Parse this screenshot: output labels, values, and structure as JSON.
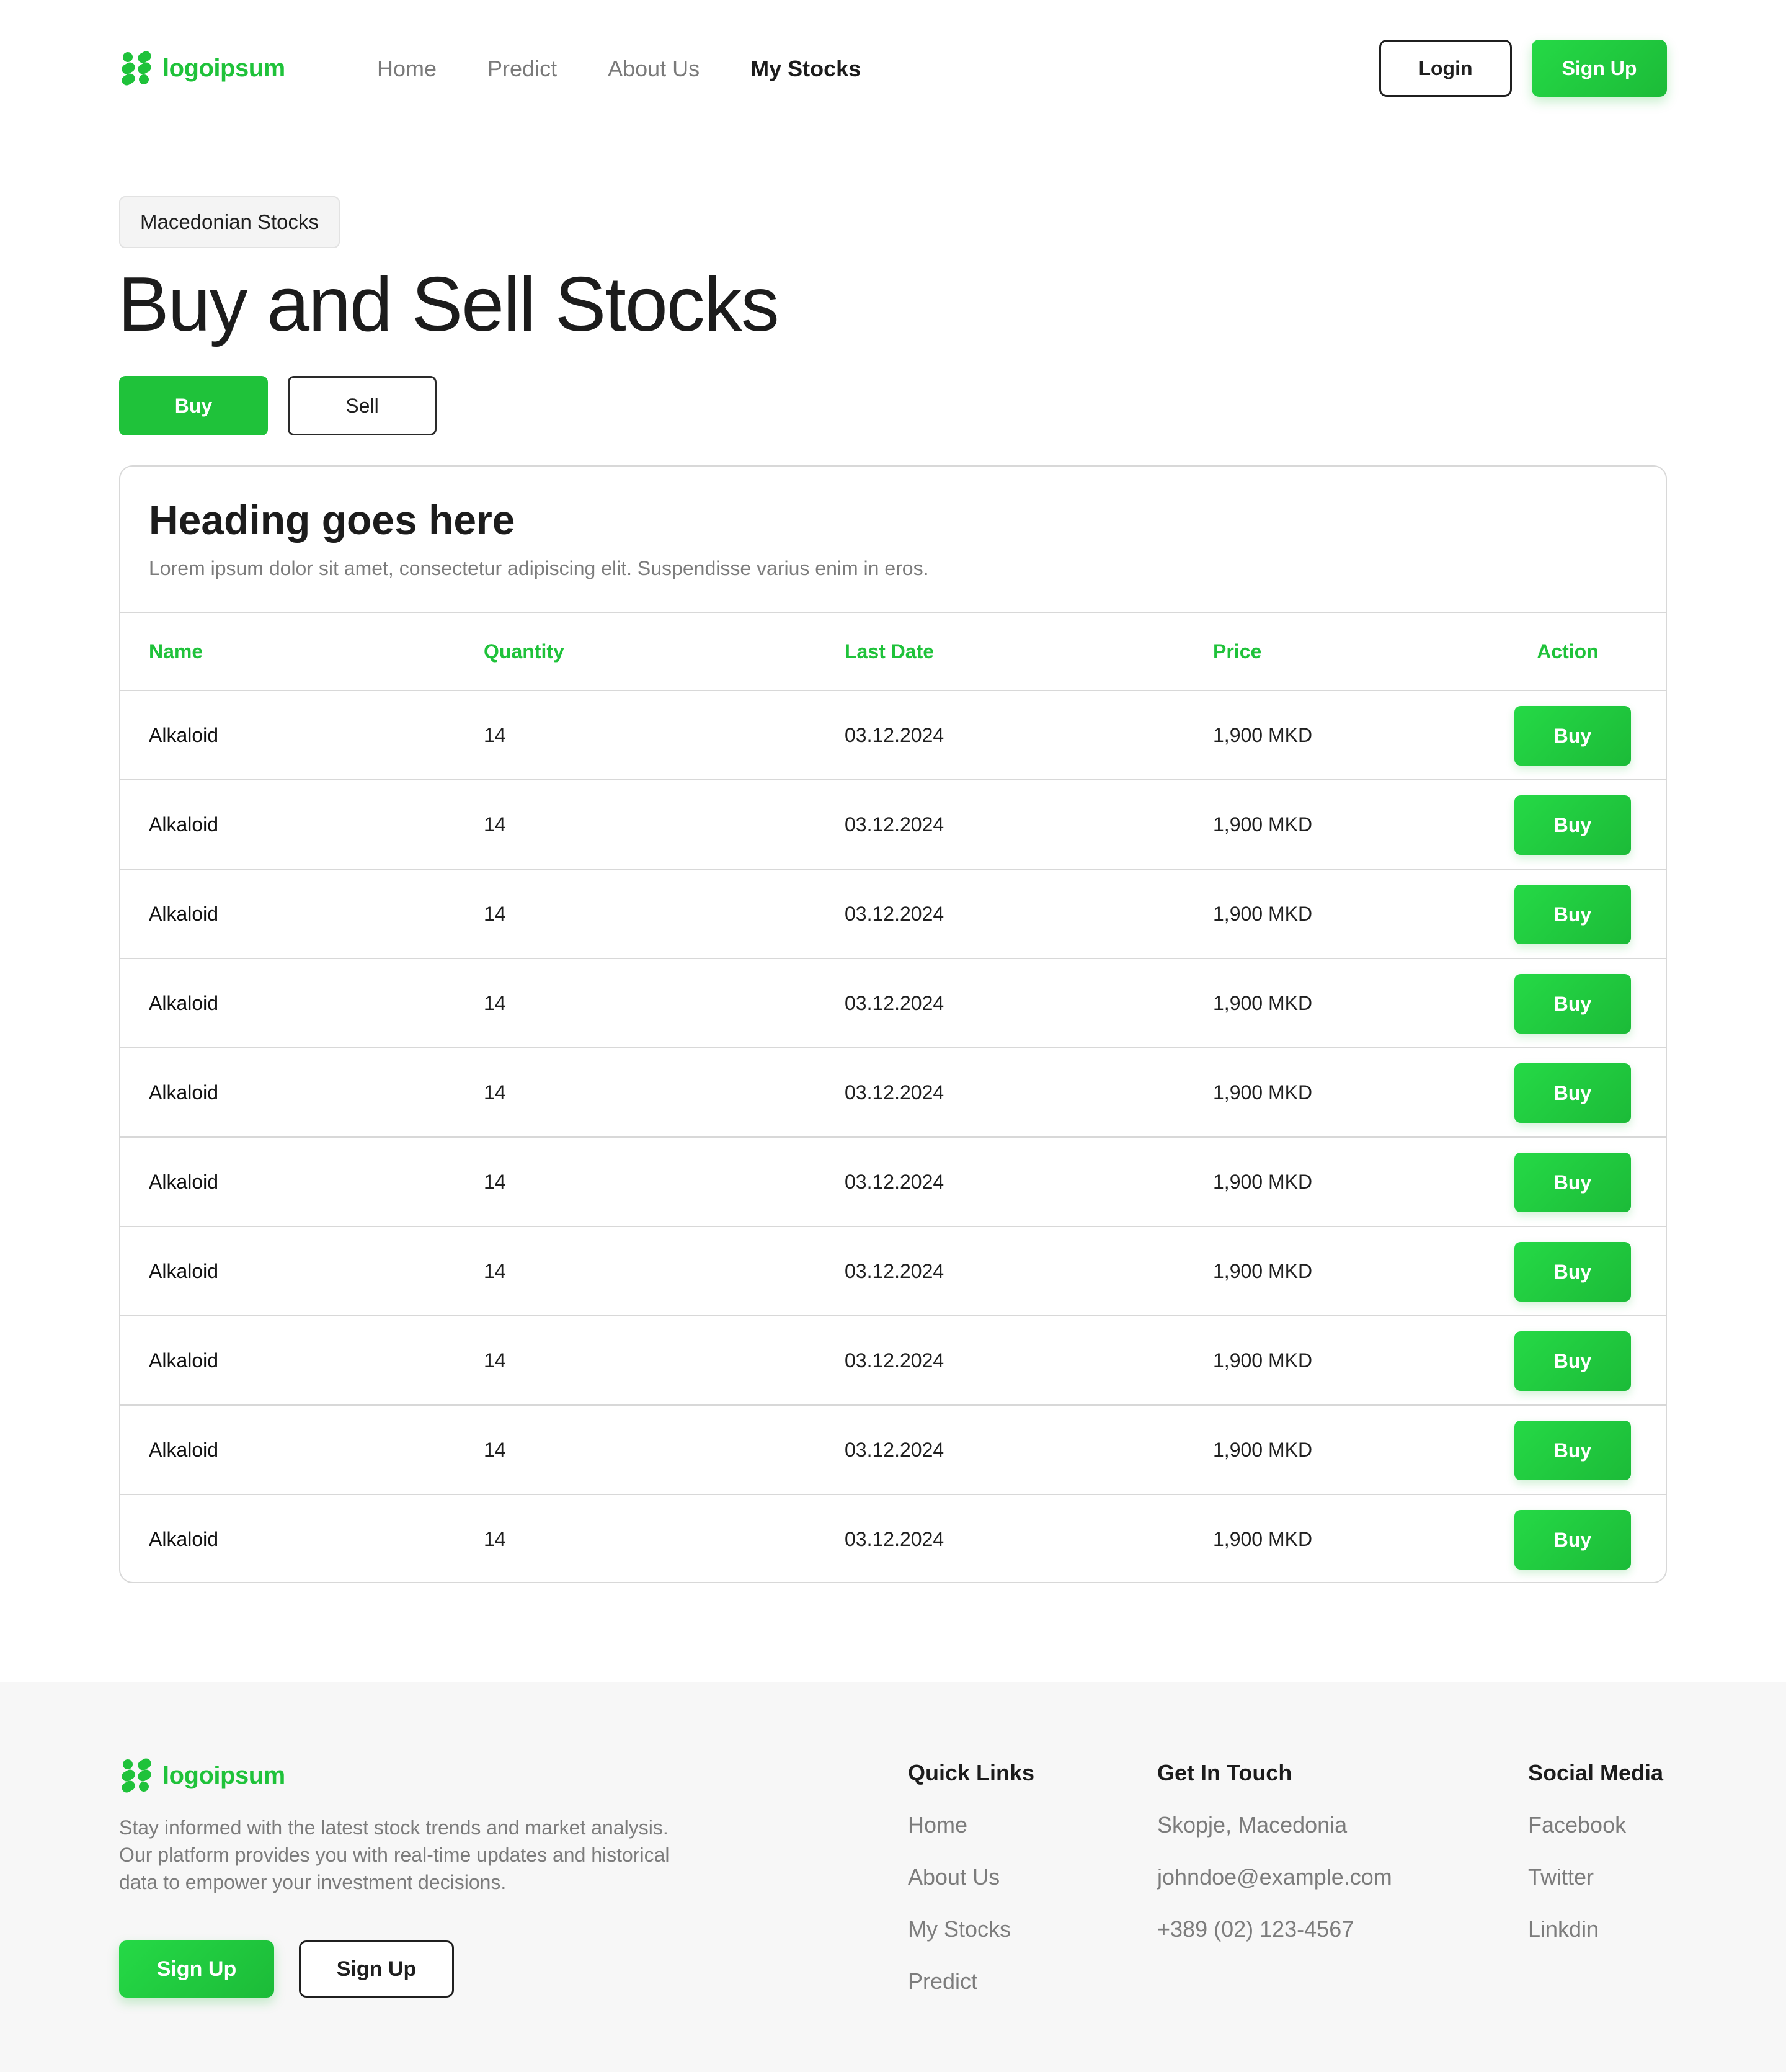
{
  "header": {
    "logo_text": "logoipsum",
    "nav": [
      {
        "label": "Home",
        "active": false
      },
      {
        "label": "Predict",
        "active": false
      },
      {
        "label": "About Us",
        "active": false
      },
      {
        "label": "My Stocks",
        "active": true
      }
    ],
    "login_label": "Login",
    "signup_label": "Sign Up"
  },
  "hero": {
    "badge": "Macedonian Stocks",
    "title": "Buy and Sell Stocks",
    "tabs": {
      "buy": "Buy",
      "sell": "Sell",
      "active": "Buy"
    }
  },
  "table": {
    "heading": "Heading goes here",
    "subheading": "Lorem ipsum dolor sit amet, consectetur adipiscing elit. Suspendisse varius enim in eros.",
    "columns": [
      "Name",
      "Quantity",
      "Last Date",
      "Price",
      "Action"
    ],
    "rows": [
      {
        "name": "Alkaloid",
        "quantity": "14",
        "last_date": "03.12.2024",
        "price": "1,900 MKD",
        "action": "Buy"
      },
      {
        "name": "Alkaloid",
        "quantity": "14",
        "last_date": "03.12.2024",
        "price": "1,900 MKD",
        "action": "Buy"
      },
      {
        "name": "Alkaloid",
        "quantity": "14",
        "last_date": "03.12.2024",
        "price": "1,900 MKD",
        "action": "Buy"
      },
      {
        "name": "Alkaloid",
        "quantity": "14",
        "last_date": "03.12.2024",
        "price": "1,900 MKD",
        "action": "Buy"
      },
      {
        "name": "Alkaloid",
        "quantity": "14",
        "last_date": "03.12.2024",
        "price": "1,900 MKD",
        "action": "Buy"
      },
      {
        "name": "Alkaloid",
        "quantity": "14",
        "last_date": "03.12.2024",
        "price": "1,900 MKD",
        "action": "Buy"
      },
      {
        "name": "Alkaloid",
        "quantity": "14",
        "last_date": "03.12.2024",
        "price": "1,900 MKD",
        "action": "Buy"
      },
      {
        "name": "Alkaloid",
        "quantity": "14",
        "last_date": "03.12.2024",
        "price": "1,900 MKD",
        "action": "Buy"
      },
      {
        "name": "Alkaloid",
        "quantity": "14",
        "last_date": "03.12.2024",
        "price": "1,900 MKD",
        "action": "Buy"
      },
      {
        "name": "Alkaloid",
        "quantity": "14",
        "last_date": "03.12.2024",
        "price": "1,900 MKD",
        "action": "Buy"
      }
    ]
  },
  "footer": {
    "logo_text": "logoipsum",
    "description_lines": [
      "Stay informed with the latest stock trends and market analysis.",
      "Our platform provides you with real-time updates and historical",
      "data to empower your investment decisions."
    ],
    "primary_button": "Sign Up",
    "secondary_button": "Sign Up",
    "quick_links": {
      "title": "Quick Links",
      "items": [
        "Home",
        "About Us",
        "My Stocks",
        "Predict"
      ]
    },
    "get_in_touch": {
      "title": "Get In Touch",
      "items": [
        "Skopje, Macedonia",
        "johndoe@example.com",
        "+389 (02) 123-4567"
      ]
    },
    "social_media": {
      "title": "Social Media",
      "items": [
        "Facebook",
        "Twitter",
        "Linkdin"
      ]
    }
  },
  "colors": {
    "accent": "#1fc23a",
    "text": "#1c1c1c",
    "muted": "#7c7c7c",
    "border": "#d8d8d8",
    "footer_bg": "#f7f7f7"
  },
  "icons": {
    "logo": "logo-mark-icon"
  }
}
